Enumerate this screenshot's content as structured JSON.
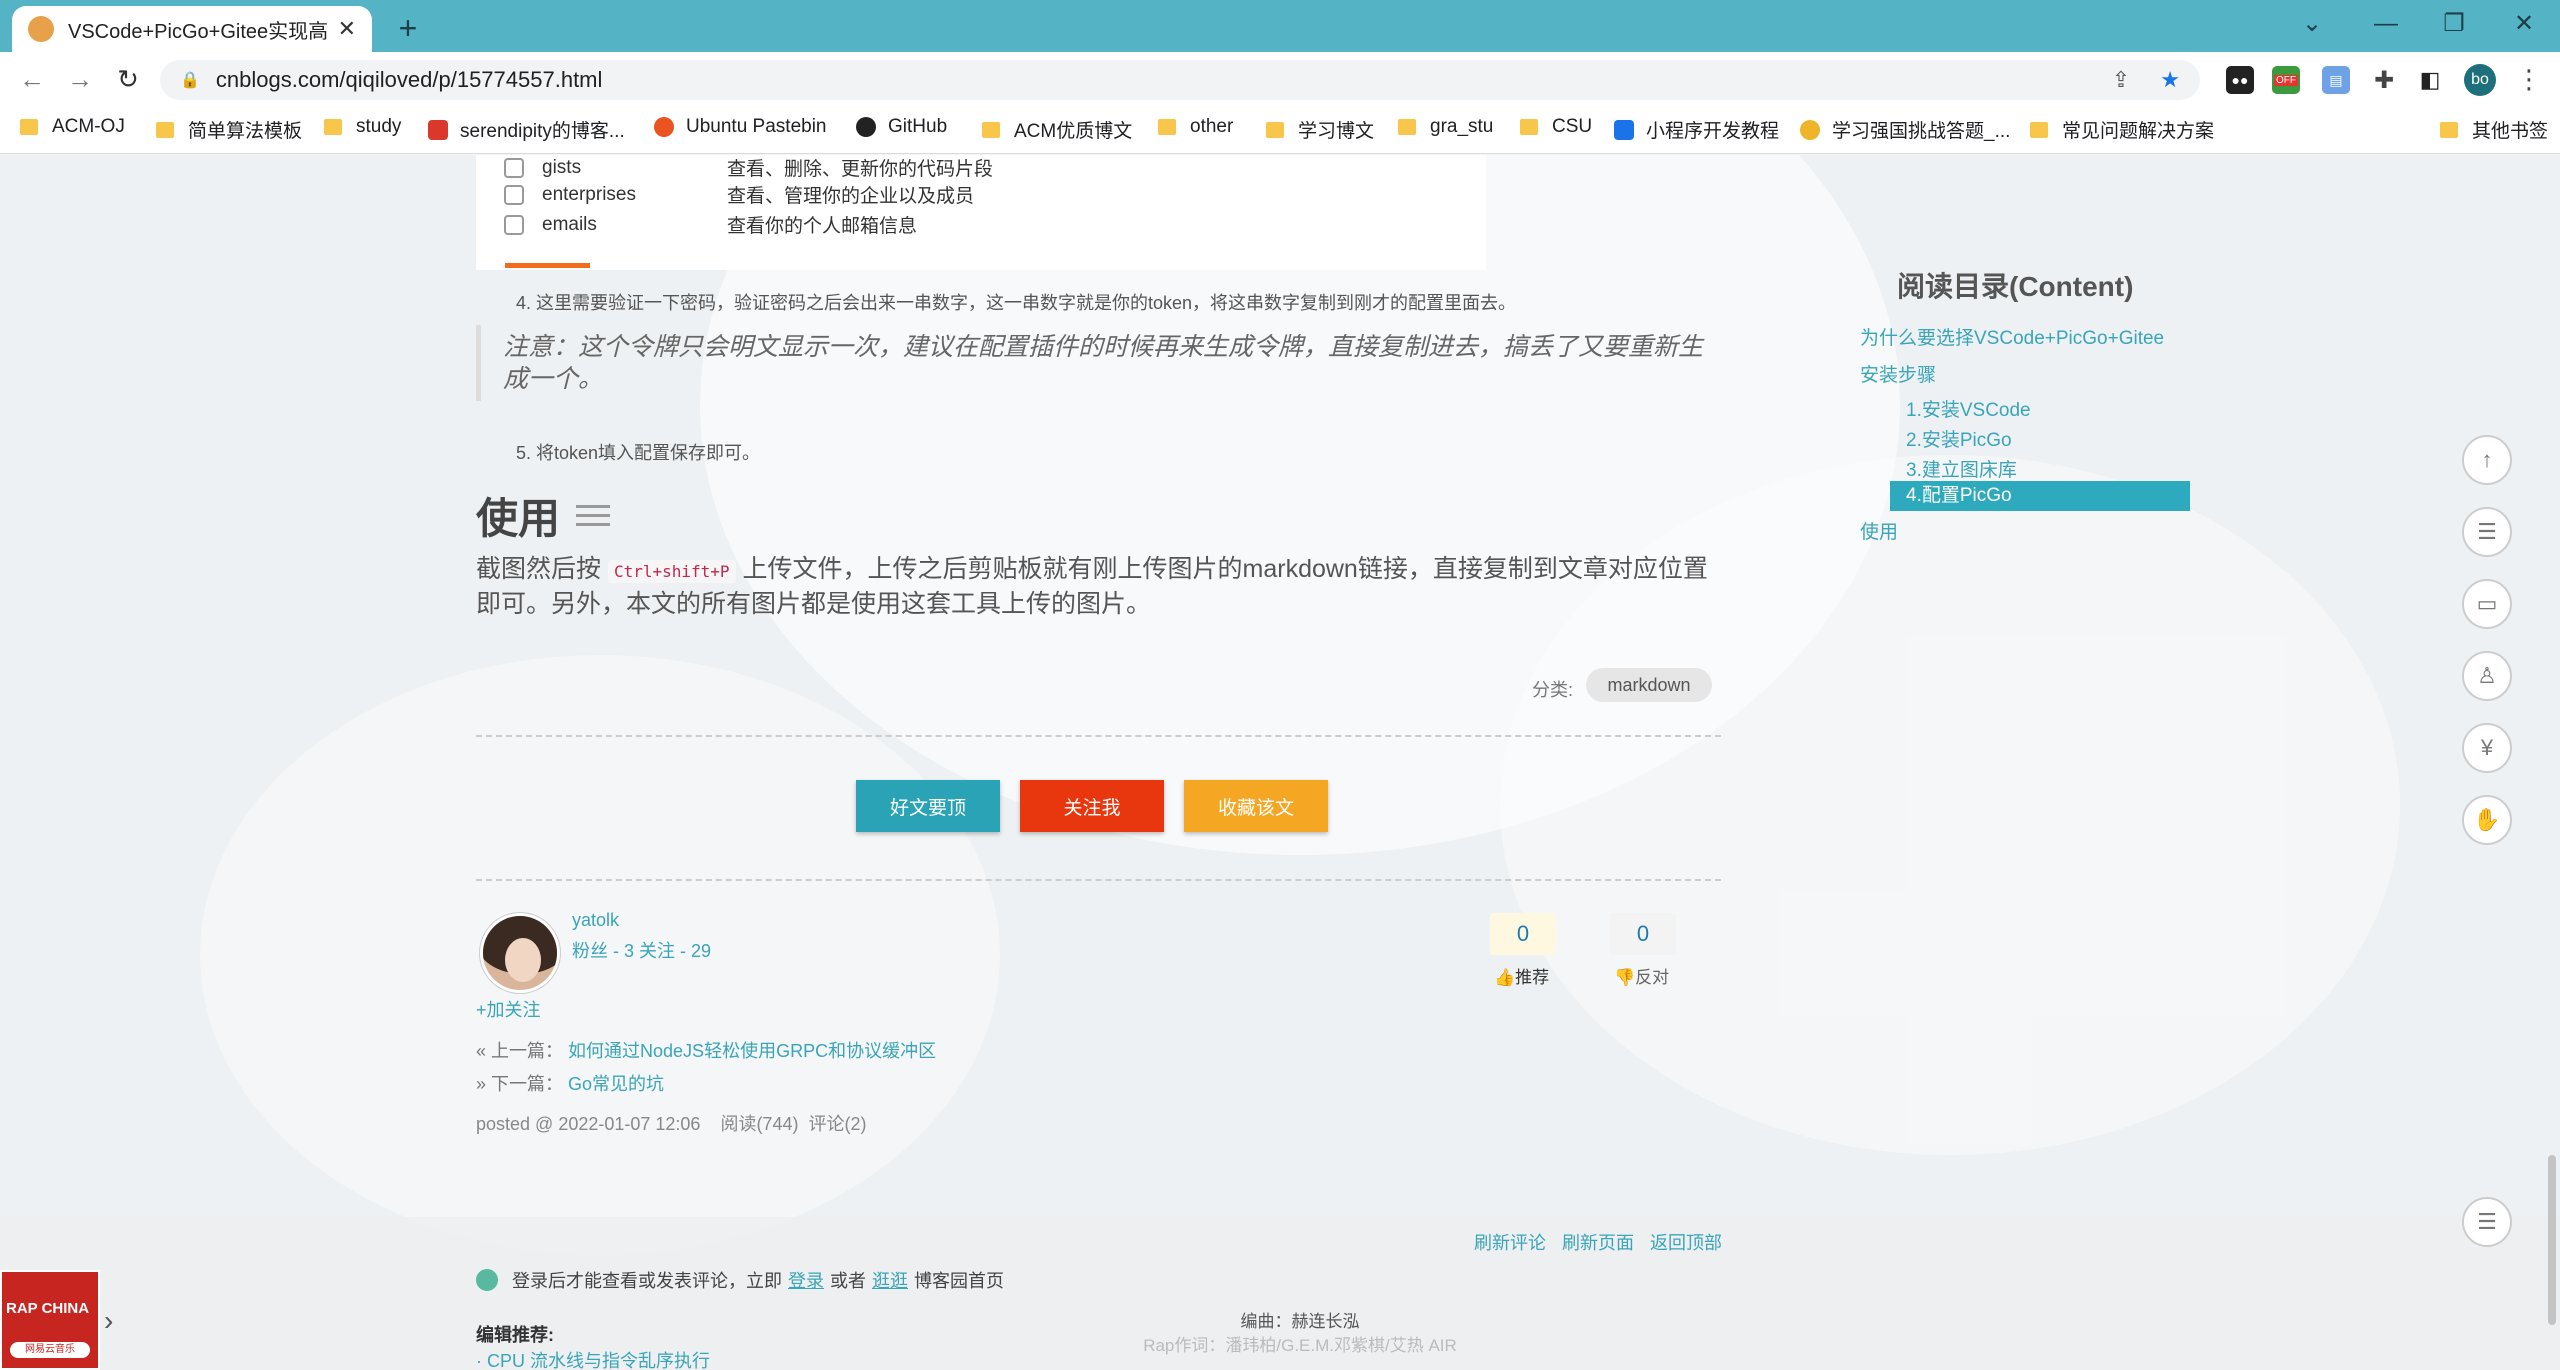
{
  "browser": {
    "tab_title": "VSCode+PicGo+Gitee实现高效",
    "tab_close": "✕",
    "new_tab": "+",
    "url": "cnblogs.com/qiqiloved/p/15774557.html",
    "profile_initials": "bo",
    "ext_off_label": "OFF",
    "window_controls": [
      "⌄",
      "—",
      "❐",
      "✕"
    ]
  },
  "bookmarks": [
    {
      "label": "ACM-OJ",
      "type": "folder"
    },
    {
      "label": "简单算法模板",
      "type": "folder"
    },
    {
      "label": "study",
      "type": "folder"
    },
    {
      "label": "serendipity的博客...",
      "type": "site",
      "color": "#d9382a"
    },
    {
      "label": "Ubuntu Pastebin",
      "type": "site",
      "color": "#e95420"
    },
    {
      "label": "GitHub",
      "type": "site",
      "color": "#222222"
    },
    {
      "label": "ACM优质博文",
      "type": "folder"
    },
    {
      "label": "other",
      "type": "folder"
    },
    {
      "label": "学习博文",
      "type": "folder"
    },
    {
      "label": "gra_stu",
      "type": "folder"
    },
    {
      "label": "CSU",
      "type": "folder"
    },
    {
      "label": "小程序开发教程",
      "type": "site",
      "color": "#1a73e8"
    },
    {
      "label": "学习强国挑战答题_...",
      "type": "site",
      "color": "#f0b429"
    },
    {
      "label": "常见问题解决方案",
      "type": "folder"
    },
    {
      "label": "其他书签",
      "type": "folder"
    }
  ],
  "permissions": [
    {
      "name": "gists",
      "desc": "查看、删除、更新你的代码片段"
    },
    {
      "name": "enterprises",
      "desc": "查看、管理你的企业以及成员"
    },
    {
      "name": "emails",
      "desc": "查看你的个人邮箱信息"
    }
  ],
  "article": {
    "step4": "4. 这里需要验证一下密码，验证密码之后会出来一串数字，这一串数字就是你的token，将这串数字复制到刚才的配置里面去。",
    "note": "注意：这个令牌只会明文显示一次，建议在配置插件的时候再来生成令牌，直接复制进去，搞丢了又要重新生成一个。",
    "step5": "5. 将token填入配置保存即可。",
    "heading": "使用",
    "para_before": "截图然后按",
    "shortcut": "Ctrl+shift+P",
    "para_after": "上传文件，上传之后剪贴板就有刚上传图片的markdown链接，直接复制到文章对应位置即可。另外，本文的所有图片都是使用这套工具上传的图片。",
    "category_label": "分类:",
    "category": "markdown"
  },
  "actions": {
    "good": "好文要顶",
    "follow": "关注我",
    "favorite": "收藏该文",
    "colors": {
      "good": "#2ba3b6",
      "follow": "#e8360e",
      "favorite": "#f5a623"
    }
  },
  "author": {
    "name": "yatolk",
    "stats": "粉丝 - 3 关注 - 29",
    "add_follow": "+加关注",
    "recommend_count": "0",
    "recommend_label": "推荐",
    "oppose_count": "0",
    "oppose_label": "反对"
  },
  "post_nav": {
    "prev_label": "« 上一篇：",
    "prev_title": "如何通过NodeJS轻松使用GRPC和协议缓冲区",
    "next_label": "» 下一篇：",
    "next_title": "Go常见的坑",
    "meta": "posted @ 2022-01-07 12:06    阅读(744)  评论(2)"
  },
  "footer": {
    "refresh_comments": "刷新评论",
    "refresh_page": "刷新页面",
    "back_top": "返回顶部",
    "login_prefix": "登录后才能查看或发表评论，立即",
    "login": "登录",
    "or": "或者",
    "browse": "逛逛",
    "login_suffix": "博客园首页",
    "editor_recommend": "编辑推荐:",
    "editor_item": "· CPU 流水线与指令乱序执行",
    "lyric1": "编曲：赫连长泓",
    "lyric2": "Rap作词：潘玮柏/G.E.M.邓紫棋/艾热 AIR"
  },
  "toc": {
    "title": "阅读目录(Content)",
    "items": [
      {
        "label": "为什么要选择VSCode+PicGo+Gitee",
        "level": 1
      },
      {
        "label": "安装步骤",
        "level": 1
      },
      {
        "label": "1.安装VSCode",
        "level": 2
      },
      {
        "label": "2.安装PicGo",
        "level": 2
      },
      {
        "label": "3.建立图床库",
        "level": 2
      },
      {
        "label": "4.配置PicGo",
        "level": 2,
        "active": true
      },
      {
        "label": "使用",
        "level": 1
      }
    ]
  },
  "music": {
    "logo_text": "RAP CHINA",
    "badge": "网易云音乐"
  }
}
